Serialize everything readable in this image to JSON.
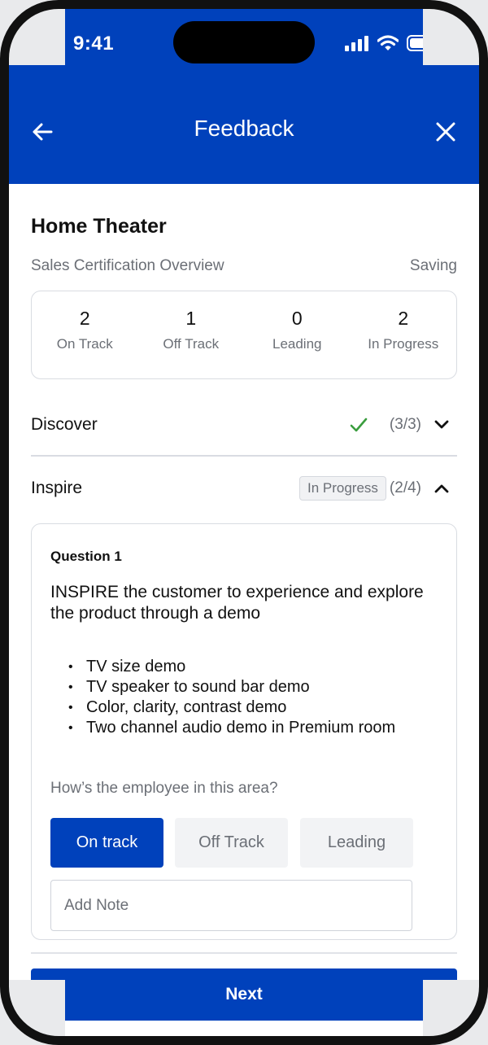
{
  "status_bar": {
    "time": "9:41"
  },
  "nav": {
    "title": "Feedback",
    "back_icon": "arrow-left-icon",
    "close_icon": "close-icon"
  },
  "page": {
    "title": "Home Theater",
    "subtitle": "Sales Certification Overview",
    "save_status": "Saving"
  },
  "summary": [
    {
      "value": "2",
      "label": "On Track"
    },
    {
      "value": "1",
      "label": "Off Track"
    },
    {
      "value": "0",
      "label": "Leading"
    },
    {
      "value": "2",
      "label": "In Progress"
    }
  ],
  "sections": [
    {
      "name": "Discover",
      "count": "(3/3)",
      "status_icon": "check-icon",
      "expanded": false
    },
    {
      "name": "Inspire",
      "count": "(2/4)",
      "badge": "In Progress",
      "expanded": true
    }
  ],
  "question": {
    "label": "Question 1",
    "text": "INSPIRE the customer to experience and explore the product through a demo",
    "items": [
      "TV size demo",
      "TV speaker to sound bar demo",
      "Color, clarity, contrast demo",
      "Two channel audio demo in Premium room"
    ],
    "prompt": "How’s the employee in this area?",
    "options": [
      "On track",
      "Off Track",
      "Leading"
    ],
    "selected": "On track",
    "note_placeholder": "Add Note"
  },
  "footer": {
    "next_label": "Next"
  },
  "colors": {
    "primary": "#0041bb",
    "check": "#3a9d3e",
    "muted": "#6b6f76"
  }
}
